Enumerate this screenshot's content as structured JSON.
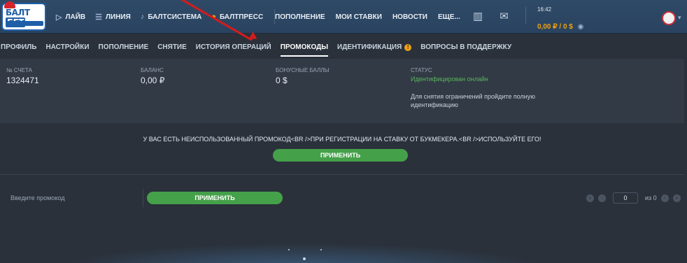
{
  "header": {
    "logo_alt": "БАЛТ БЕТ",
    "nav": [
      {
        "label": "ЛАЙВ",
        "icon": "play-icon"
      },
      {
        "label": "ЛИНИЯ",
        "icon": "list-icon"
      },
      {
        "label": "БАЛТСИСТЕМА",
        "icon": "guitar-icon"
      },
      {
        "label": "БАЛТПРЕСС",
        "icon": "fire-icon"
      }
    ],
    "nav2": [
      "ПОПОЛНЕНИЕ",
      "МОИ СТАВКИ",
      "НОВОСТИ",
      "ЕЩЕ..."
    ],
    "time": "16:42",
    "balance": "0,00 ₽ / 0 $"
  },
  "tabs": [
    {
      "label": "ПРОФИЛЬ"
    },
    {
      "label": "НАСТРОЙКИ"
    },
    {
      "label": "ПОПОЛНЕНИЕ"
    },
    {
      "label": "СНЯТИЕ"
    },
    {
      "label": "ИСТОРИЯ ОПЕРАЦИЙ"
    },
    {
      "label": "ПРОМОКОДЫ"
    },
    {
      "label": "ИДЕНТИФИКАЦИЯ",
      "badge": "!"
    },
    {
      "label": "ВОПРОСЫ В ПОДДЕРЖКУ"
    }
  ],
  "account": {
    "account_no_label": "№ СЧЕТА",
    "account_no": "1324471",
    "balance_label": "БАЛАНС",
    "balance": "0,00 ₽",
    "bonus_label": "БОНУСНЫЕ БАЛЛЫ",
    "bonus": "0 $",
    "status_label": "СТАТУС",
    "status": "Идентифицирован онлайн",
    "status_note": "Для снятия ограничений пройдите полную идентификацию"
  },
  "promo": {
    "notice": "У ВАС ЕСТЬ НЕИСПОЛЬЗОВАННЫЙ ПРОМОКОД<BR />ПРИ РЕГИСТРАЦИИ НА СТАВКУ ОТ БУКМЕКЕРА.<BR />ИСПОЛЬЗУЙТЕ ЕГО!",
    "apply_label": "ПРИМЕНИТЬ",
    "input_placeholder": "Введите промокод",
    "apply_label_2": "ПРИМЕНИТЬ"
  },
  "pager": {
    "page": "0",
    "of_text": "из 0"
  }
}
